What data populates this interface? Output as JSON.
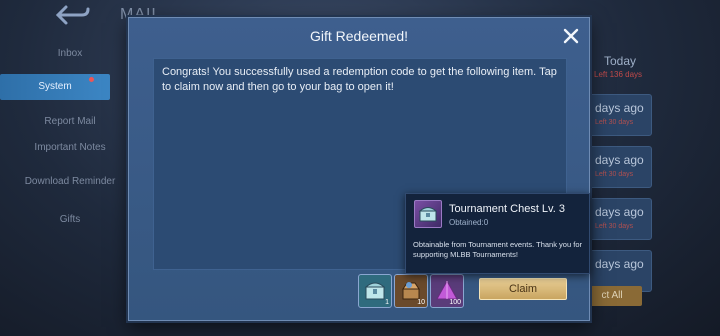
{
  "background": {
    "title": "MAIL",
    "sidebar": [
      {
        "label": "Inbox"
      },
      {
        "label": "System"
      },
      {
        "label": "Report Mail"
      },
      {
        "label": "Important Notes"
      },
      {
        "label": "Download Reminder"
      },
      {
        "label": "Gifts"
      }
    ],
    "today_label": "Today",
    "today_sub": "Left 136 days",
    "cards": [
      {
        "days": "days ago",
        "sub": "Left 30 days"
      },
      {
        "days": "days ago",
        "sub": "Left 30 days"
      },
      {
        "days": "days ago",
        "sub": "Left 30 days"
      },
      {
        "days": "days ago",
        "sub": ""
      }
    ],
    "delete_label": "ct All"
  },
  "dialog": {
    "title": "Gift Redeemed!",
    "message": "Congrats! You successfully used a redemption code to get the following item. Tap to claim now and then go to your bag to open it!",
    "rewards": [
      {
        "icon": "chest-icon",
        "count": "1",
        "color": "#2f6b7e"
      },
      {
        "icon": "fragment-icon",
        "count": "10",
        "color": "#6a4a2c"
      },
      {
        "icon": "crystal-icon",
        "count": "100",
        "color": "#5a3c7a"
      }
    ],
    "claim_label": "Claim"
  },
  "tooltip": {
    "name": "Tournament Chest Lv. 3",
    "obtained": "Obtained:0",
    "description": "Obtainable from Tournament events. Thank you for supporting MLBB Tournaments!"
  }
}
